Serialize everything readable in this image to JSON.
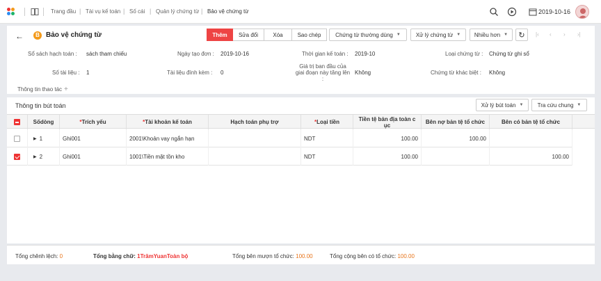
{
  "topbar": {
    "breadcrumb": [
      "Trang đầu",
      "Tài vụ kế toán",
      "Số cái",
      "Quản lý chứng từ",
      "Bảo vệ chứng từ"
    ],
    "date": "2019-10-16",
    "icons": [
      "app-logo",
      "book-icon",
      "search-icon",
      "play-icon",
      "calendar-icon",
      "user-avatar"
    ]
  },
  "header": {
    "title": "Bảo vệ chứng từ",
    "title_badge": "B",
    "actions": [
      "Thêm",
      "Sửa đổi",
      "Xóa",
      "Sao chép"
    ],
    "dropdowns": [
      "Chứng từ thường dùng",
      "Xử lý chứng từ",
      "Nhiều hơn"
    ],
    "accent": "#ee4444"
  },
  "form": {
    "fields": [
      {
        "label": "Sổ sách hạch toán",
        "value": "sách tham chiếu"
      },
      {
        "label": "Ngày tạo đơn",
        "value": "2019-10-16"
      },
      {
        "label": "Thời gian kế toán",
        "value": "2019-10"
      },
      {
        "label": "Loại chứng từ",
        "value": "Chứng từ ghi sổ"
      },
      {
        "label": "Số tài liệu",
        "value": "1"
      },
      {
        "label": "Tài liệu đính kèm",
        "value": "0"
      },
      {
        "label": "Giá trị ban đầu của giai đoạn này tăng lên",
        "value": "Không"
      },
      {
        "label": "Chứng từ khác biệt",
        "value": "Không"
      }
    ],
    "ops_label": "Thông tin thao tác"
  },
  "grid": {
    "title": "Thông tin bút toán",
    "buttons": [
      "Xử lý bút toán",
      "Tra cứu chung"
    ],
    "columns": [
      "Sốdòng",
      "Trích yếu",
      "Tài khoản kế toán",
      "Hạch toán phụ trợ",
      "Loại tiền",
      "Tiền tệ bản địa toàn c ục",
      "Bên nợ bản tệ tổ chức",
      "Bên có bản tệ tổ chức"
    ],
    "rows": [
      {
        "no": "1",
        "summary": "Ghi001",
        "account": "2001\\Khoản vay ngắn hạn",
        "aux": "",
        "currency": "NDT",
        "local": "100.00",
        "debit": "100.00",
        "credit": "",
        "checked": false
      },
      {
        "no": "2",
        "summary": "Ghi001",
        "account": "1001\\Tiền mặt tồn kho",
        "aux": "",
        "currency": "NDT",
        "local": "100.00",
        "debit": "",
        "credit": "100.00",
        "checked": true
      }
    ]
  },
  "footer": {
    "diff_label": "Tổng chênh lệch:",
    "diff_value": "0",
    "words_label": "Tổng bằng chữ:",
    "words_value": "1TrămYuanToàn bộ",
    "borrow_label": "Tổng bên mượn tổ chức:",
    "borrow_value": "100.00",
    "credit_label": "Tổng cộng bên có tổ chức:",
    "credit_value": "100.00"
  }
}
